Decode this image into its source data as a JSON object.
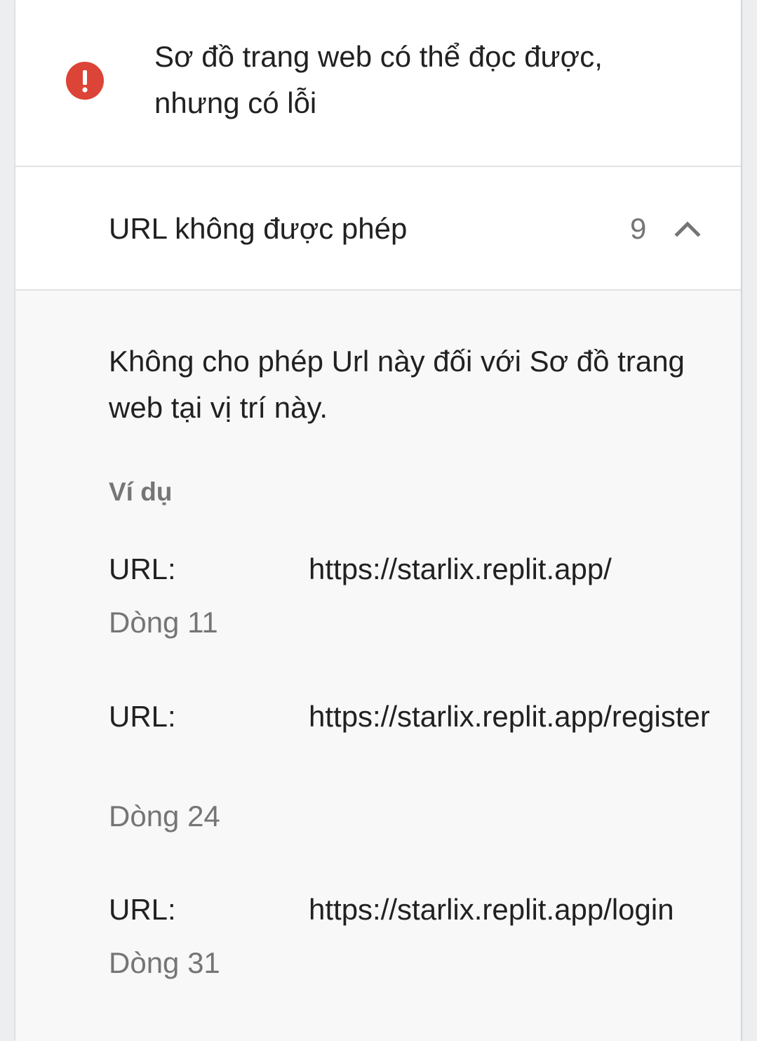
{
  "status": {
    "icon": "error-icon",
    "icon_color": "#db4437",
    "text": "Sơ đồ trang web có thể đọc được, nhưng có lỗi"
  },
  "issue": {
    "title": "URL không được phép",
    "count": "9",
    "toggle_icon": "chevron-up-icon"
  },
  "details": {
    "description": "Không cho phép Url này đối với Sơ đồ trang web tại vị trí này.",
    "examples_heading": "Ví dụ",
    "examples": [
      {
        "label": "URL:",
        "url": "https://starlix.replit.app/",
        "line": "Dòng 11"
      },
      {
        "label": "URL:",
        "url": "https://starlix.replit.app/register",
        "line": "Dòng 24"
      },
      {
        "label": "URL:",
        "url": "https://starlix.replit.app/login",
        "line": "Dòng 31"
      }
    ]
  }
}
